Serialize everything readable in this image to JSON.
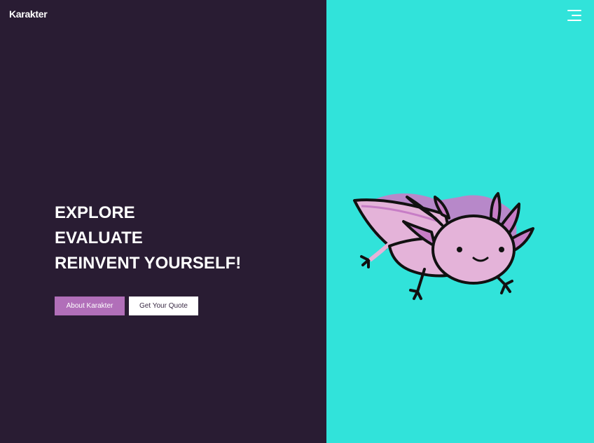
{
  "brand": {
    "logo_text": "Karakter"
  },
  "hero": {
    "lines": [
      "EXPLORE",
      "EVALUATE",
      "REINVENT YOURSELF!"
    ]
  },
  "buttons": {
    "primary": "About Karakter",
    "secondary": "Get Your Quote"
  },
  "icons": {
    "menu": "hamburger-menu-icon",
    "illustration": "axolotl-illustration"
  },
  "colors": {
    "left_panel": "#291c33",
    "right_panel": "#31e3da",
    "primary_button": "#b16fb9",
    "axolotl_body": "#e4b3d9",
    "axolotl_accent": "#c77dc6"
  }
}
